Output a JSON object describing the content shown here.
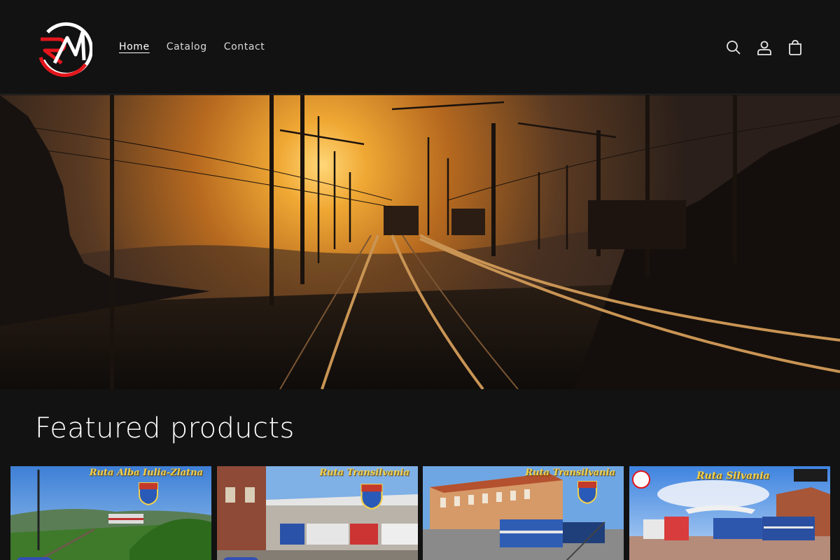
{
  "header": {
    "nav": [
      {
        "label": "Home",
        "active": true
      },
      {
        "label": "Catalog",
        "active": false
      },
      {
        "label": "Contact",
        "active": false
      }
    ],
    "icons": [
      "search-icon",
      "account-icon",
      "cart-icon"
    ]
  },
  "featured": {
    "title": "Featured products",
    "products": [
      {
        "name": "Ruta Alba Iulia-Zlatna"
      },
      {
        "name": "Ruta Transilvania"
      },
      {
        "name": "Ruta Transilvania"
      },
      {
        "name": "Ruta Silvania"
      }
    ]
  },
  "colors": {
    "background": "#121212",
    "logo_red": "#e3161c",
    "badge_blue": "#334fb4",
    "title_gold": "#f2d04a"
  }
}
